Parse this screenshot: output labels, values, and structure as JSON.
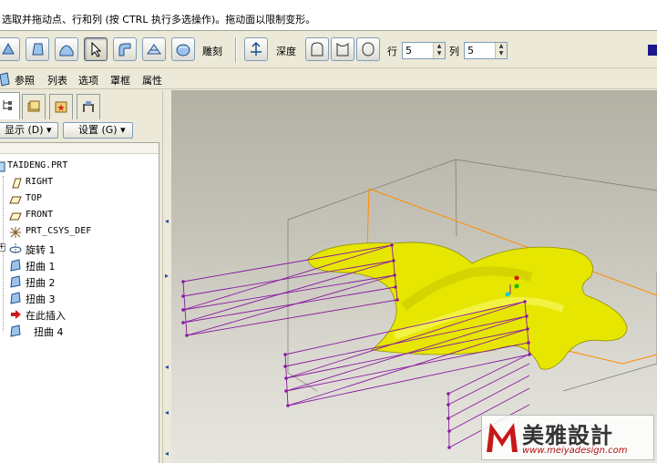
{
  "message_bar": {
    "text": "选取并拖动点、行和列 (按 CTRL 执行多选操作)。拖动面以限制变形。"
  },
  "toolbar": {
    "sculpt_label": "雕刻",
    "depth_label": "深度",
    "rows_label": "行",
    "rows_value": "5",
    "cols_label": "列",
    "cols_value": "5"
  },
  "tabs": {
    "references": "参照",
    "list": "列表",
    "options": "选项",
    "frame": "罩框",
    "properties": "属性"
  },
  "panel": {
    "show_button": "显示 (D) ▾",
    "settings_button": "设置 (G) ▾"
  },
  "tree": [
    {
      "label": "TAIDENG.PRT",
      "icon": "part-icon"
    },
    {
      "label": "RIGHT",
      "icon": "datum-plane-icon"
    },
    {
      "label": "TOP",
      "icon": "datum-plane-icon"
    },
    {
      "label": "FRONT",
      "icon": "datum-plane-icon"
    },
    {
      "label": "PRT_CSYS_DEF",
      "icon": "coordinate-system-icon"
    },
    {
      "label": "旋转 1",
      "icon": "revolve-icon"
    },
    {
      "label": "扭曲 1",
      "icon": "warp-icon"
    },
    {
      "label": "扭曲 2",
      "icon": "warp-icon"
    },
    {
      "label": "扭曲 3",
      "icon": "warp-icon"
    },
    {
      "label": "在此插入",
      "icon": "insert-here-arrow-icon"
    },
    {
      "label": "扭曲 4",
      "icon": "warp-icon"
    }
  ],
  "watermark": {
    "brand": "美雅設計",
    "url": "www.meiyadesign.com"
  },
  "colors": {
    "surface": "#e6e600",
    "control_mesh": "#8a1aa0",
    "bounding_box": "#ff8c00"
  }
}
